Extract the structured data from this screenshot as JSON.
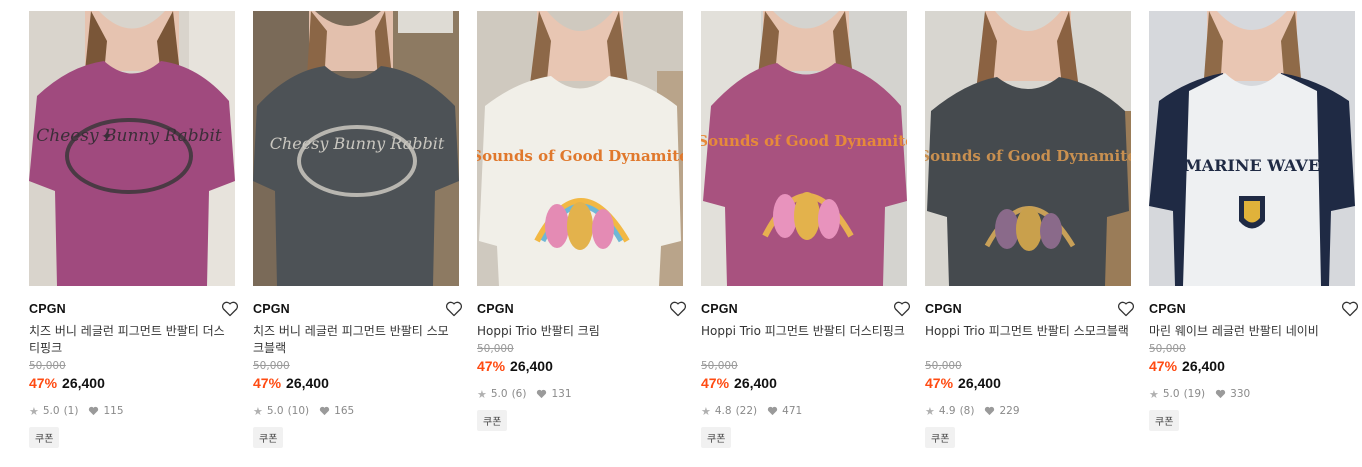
{
  "products": [
    {
      "brand": "CPGN",
      "name": "치즈 버니 레글런 피그먼트 반팔티 더스티핑크",
      "original_price": "50,000",
      "discount": "47%",
      "price": "26,400",
      "rating": "5.0",
      "reviews": "(1)",
      "likes": "115",
      "coupon": "쿠폰",
      "shirt_color": "#a04a7e",
      "bg_color": "#d9d4cc",
      "print_text": "Cheesy Bunny Rabbit",
      "heart_icon": "heart-outline-icon"
    },
    {
      "brand": "CPGN",
      "name": "치즈 버니 레글런 피그먼트 반팔티 스모크블랙",
      "original_price": "50,000",
      "discount": "47%",
      "price": "26,400",
      "rating": "5.0",
      "reviews": "(10)",
      "likes": "165",
      "coupon": "쿠폰",
      "shirt_color": "#4d5256",
      "bg_color": "#7a6a58",
      "print_text": "Cheesy Bunny Rabbit",
      "heart_icon": "heart-outline-icon"
    },
    {
      "brand": "CPGN",
      "name": "Hoppi Trio 반팔티 크림",
      "original_price": "50,000",
      "discount": "47%",
      "price": "26,400",
      "rating": "5.0",
      "reviews": "(6)",
      "likes": "131",
      "coupon": "쿠폰",
      "shirt_color": "#f1efe8",
      "bg_color": "#cfc9bf",
      "print_text": "Sounds of Good Dynamite",
      "heart_icon": "heart-outline-icon"
    },
    {
      "brand": "CPGN",
      "name": "Hoppi Trio 피그먼트 반팔티 더스티핑크",
      "original_price": "50,000",
      "discount": "47%",
      "price": "26,400",
      "rating": "4.8",
      "reviews": "(22)",
      "likes": "471",
      "coupon": "쿠폰",
      "shirt_color": "#a8527f",
      "bg_color": "#d4d3cf",
      "print_text": "Sounds of Good Dynamite",
      "heart_icon": "heart-outline-icon"
    },
    {
      "brand": "CPGN",
      "name": "Hoppi Trio 피그먼트 반팔티 스모크블랙",
      "original_price": "50,000",
      "discount": "47%",
      "price": "26,400",
      "rating": "4.9",
      "reviews": "(8)",
      "likes": "229",
      "coupon": "쿠폰",
      "shirt_color": "#454a4e",
      "bg_color": "#d8d6d0",
      "print_text": "Sounds of Good Dynamite",
      "heart_icon": "heart-outline-icon"
    },
    {
      "brand": "CPGN",
      "name": "마린 웨이브 레글런 반팔티 네이비",
      "original_price": "50,000",
      "discount": "47%",
      "price": "26,400",
      "rating": "5.0",
      "reviews": "(19)",
      "likes": "330",
      "coupon": "쿠폰",
      "shirt_color": "#eef0f2",
      "sleeve_color": "#1f2a44",
      "bg_color": "#d6d8dc",
      "print_text": "MARINE WAVE",
      "heart_icon": "heart-outline-icon"
    }
  ],
  "colors": {
    "discount": "#ff4b12",
    "muted": "#9a9a9a",
    "coupon_bg": "#f1f1f1"
  }
}
